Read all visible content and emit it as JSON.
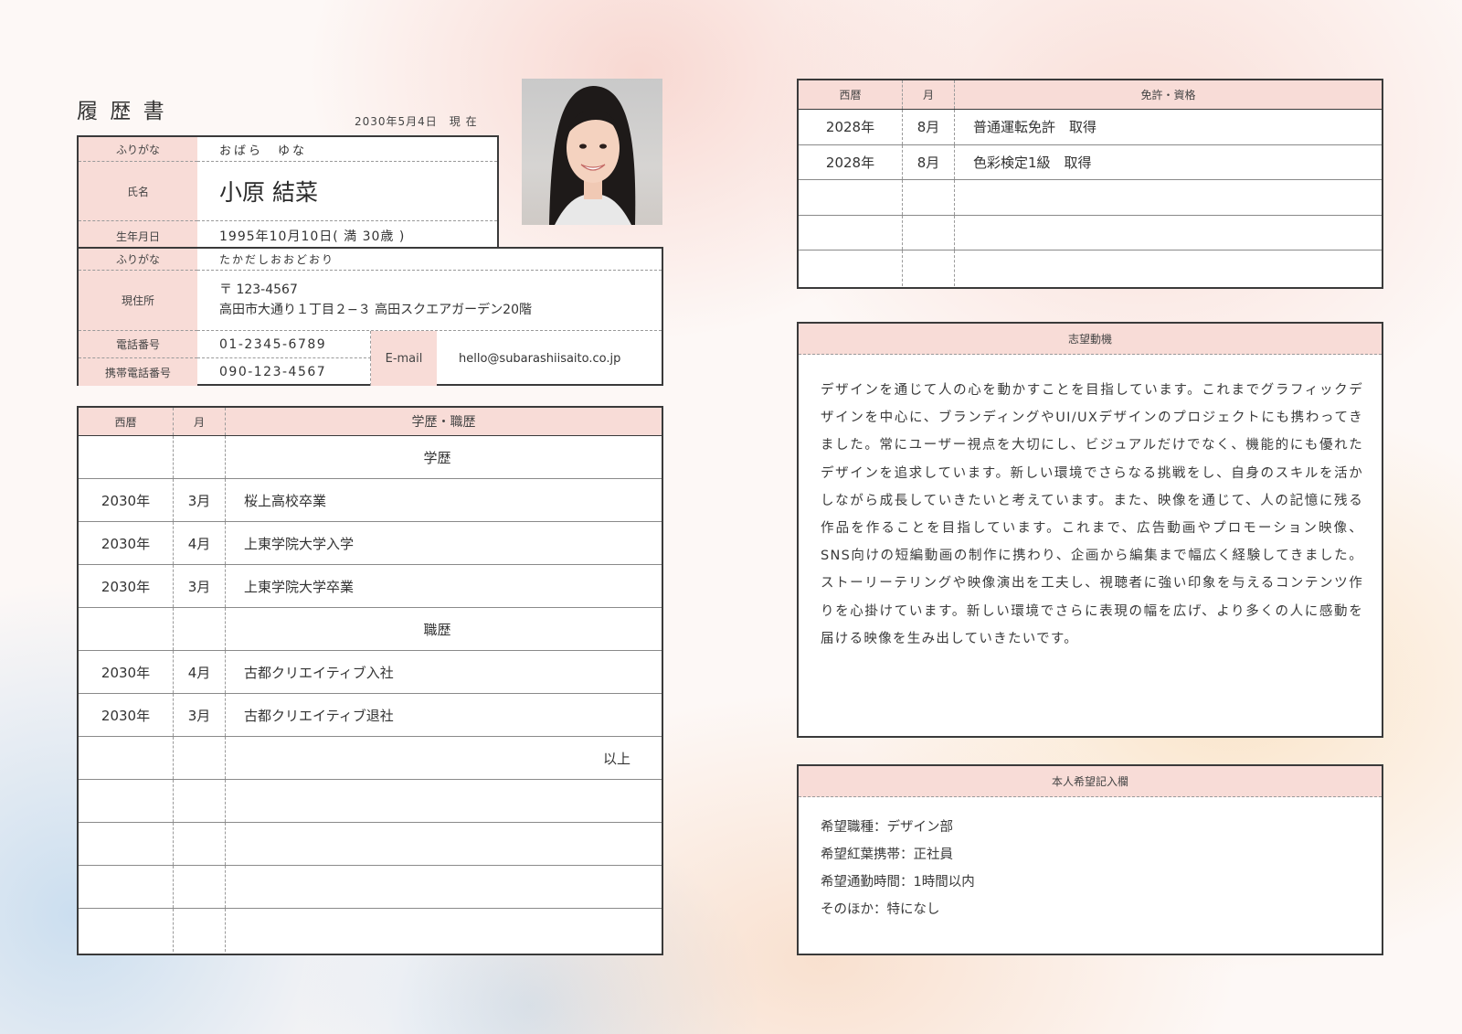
{
  "header": {
    "title": "履 歴 書",
    "date_text": "2030年5月4日　現 在"
  },
  "profile": {
    "furigana_label": "ふりがな",
    "furigana_value": "おばら　ゆな",
    "name_label": "氏名",
    "name_value": "小原 結菜",
    "birth_label": "生年月日",
    "birth_value": "1995年10月10日( 満 30歳 )",
    "addr_furigana_label": "ふりがな",
    "addr_furigana_value": "たかだしおおどおり",
    "address_label": "現住所",
    "postal": "〒 123-4567",
    "address": "高田市大通り１丁目２−３ 高田スクエアガーデン20階",
    "phone_label": "電話番号",
    "phone_value": "01-2345-6789",
    "mobile_label": "携帯電話番号",
    "mobile_value": "090-123-4567",
    "email_label": "E-mail",
    "email_value": "hello@subarashiisaito.co.jp"
  },
  "history": {
    "headers": [
      "西暦",
      "月",
      "学歴・職歴"
    ],
    "rows": [
      {
        "year": "",
        "month": "",
        "text": "学歴",
        "align": "center"
      },
      {
        "year": "2030年",
        "month": "3月",
        "text": "桜上高校卒業",
        "align": "left"
      },
      {
        "year": "2030年",
        "month": "4月",
        "text": "上東学院大学入学",
        "align": "left"
      },
      {
        "year": "2030年",
        "month": "3月",
        "text": "上東学院大学卒業",
        "align": "left"
      },
      {
        "year": "",
        "month": "",
        "text": "職歴",
        "align": "center"
      },
      {
        "year": "2030年",
        "month": "4月",
        "text": "古都クリエイティブ入社",
        "align": "left"
      },
      {
        "year": "2030年",
        "month": "3月",
        "text": "古都クリエイティブ退社",
        "align": "left"
      },
      {
        "year": "",
        "month": "",
        "text": "以上",
        "align": "right"
      },
      {
        "year": "",
        "month": "",
        "text": "",
        "align": "left"
      },
      {
        "year": "",
        "month": "",
        "text": "",
        "align": "left"
      },
      {
        "year": "",
        "month": "",
        "text": "",
        "align": "left"
      },
      {
        "year": "",
        "month": "",
        "text": "",
        "align": "left"
      }
    ]
  },
  "licenses": {
    "headers": [
      "西暦",
      "月",
      "免許・資格"
    ],
    "rows": [
      {
        "year": "2028年",
        "month": "8月",
        "text": "普通運転免許　取得"
      },
      {
        "year": "2028年",
        "month": "8月",
        "text": "色彩検定1級　取得"
      },
      {
        "year": "",
        "month": "",
        "text": ""
      },
      {
        "year": "",
        "month": "",
        "text": ""
      },
      {
        "year": "",
        "month": "",
        "text": ""
      }
    ]
  },
  "motivation": {
    "title": "志望動機",
    "body": "デザインを通じて人の心を動かすことを目指しています。これまでグラフィックデザインを中心に、ブランディングやUI/UXデザインのプロジェクトにも携わってきました。常にユーザー視点を大切にし、ビジュアルだけでなく、機能的にも優れたデザインを追求しています。新しい環境でさらなる挑戦をし、自身のスキルを活かしながら成長していきたいと考えています。また、映像を通じて、人の記憶に残る作品を作ることを目指しています。これまで、広告動画やプロモーション映像、SNS向けの短編動画の制作に携わり、企画から編集まで幅広く経験してきました。ストーリーテリングや映像演出を工夫し、視聴者に強い印象を与えるコンテンツ作りを心掛けています。新しい環境でさらに表現の幅を広げ、より多くの人に感動を届ける映像を生み出していきたいです。"
  },
  "requests": {
    "title": "本人希望記入欄",
    "lines": [
      "希望職種：デザイン部",
      "希望紅葉携帯：正社員",
      "希望通勤時間：1時間以内",
      "そのほか：特になし"
    ]
  }
}
